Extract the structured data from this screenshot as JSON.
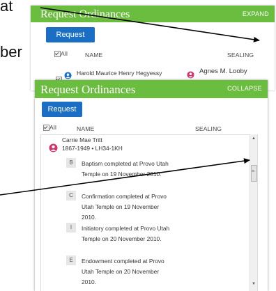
{
  "slide": {
    "frag_at": "at",
    "frag_ber": "ber"
  },
  "back_panel": {
    "title": "Request Ordinances",
    "expand_label": "EXPAND",
    "request_label": "Request",
    "col_all": "All",
    "col_name": "NAME",
    "col_sealing": "SEALING",
    "row_name": "Harold Maurice Henry Hegyessy",
    "row_spouse": "Agnes M. Looby"
  },
  "front_panel": {
    "title": "Request Ordinances",
    "collapse_label": "COLLAPSE",
    "request_label": "Request",
    "col_all": "All",
    "col_name": "NAME",
    "col_sealing": "SEALING",
    "person": {
      "name": "Carrie Mae Tritt",
      "details": "1867-1949 • LH34-1KH"
    },
    "ordinances": [
      {
        "letter": "B",
        "text": "Baptism completed at Provo Utah Temple on 19 November 2010."
      },
      {
        "letter": "C",
        "text": "Confirmation completed at Provo Utah Temple on 19 November 2010."
      },
      {
        "letter": "I",
        "text": "Initiatory completed at Provo Utah Temple on 20 November 2010."
      },
      {
        "letter": "E",
        "text": "Endowment completed at Provo Utah Temple on 20 November 2010."
      }
    ]
  },
  "colors": {
    "header_green": "#6bbd3f",
    "button_blue": "#1a6fc5",
    "female_icon": "#d6336c",
    "male_icon": "#1a6fc5"
  }
}
